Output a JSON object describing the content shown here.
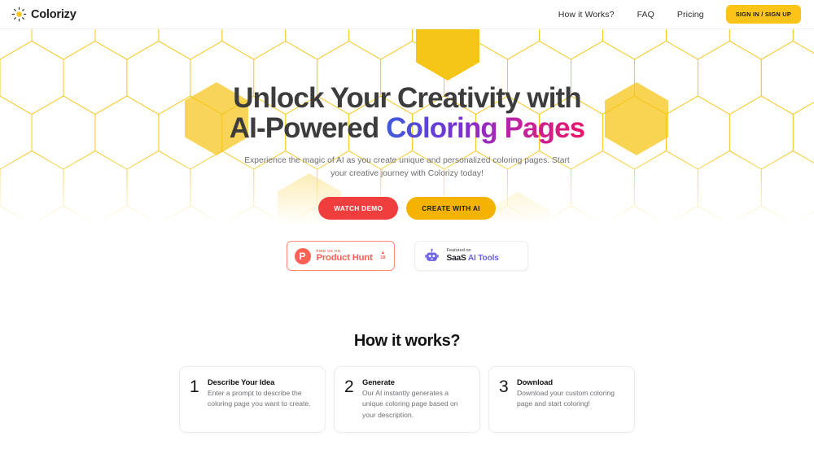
{
  "header": {
    "logo_icon": "sun-icon",
    "brand": "Colorizy",
    "nav": [
      {
        "label": "How it Works?"
      },
      {
        "label": "FAQ"
      },
      {
        "label": "Pricing"
      }
    ],
    "cta": "SIGN IN / SIGN UP",
    "cta_color": "#FCC419"
  },
  "hero": {
    "title_line1": "Unlock Your Creativity with",
    "title_line2_plain": "AI-Powered ",
    "title_line2_gradient": "Coloring Pages",
    "subtitle": "Experience the magic of AI as you create unique and personalized coloring pages. Start your creative journey with Colorizy today!",
    "buttons": [
      {
        "label": "WATCH DEMO",
        "color": "#F03E3E"
      },
      {
        "label": "CREATE WITH AI",
        "color": "#F5B301"
      }
    ],
    "background": "honeycomb-hexagon-pattern",
    "hex_color": "#F5C518"
  },
  "badges": {
    "product_hunt": {
      "icon": "product-hunt-icon",
      "eyebrow": "FIND US ON",
      "name": "Product Hunt",
      "upvote_icon": "caret-up-icon",
      "votes": "18",
      "color": "#FF6154"
    },
    "saas_ai_tools": {
      "icon": "robot-icon",
      "eyebrow": "Featured on",
      "name_bold": "SaaS",
      "name_accent": " AI Tools",
      "color": "#6C63E8"
    }
  },
  "how_it_works": {
    "title": "How it works?",
    "steps": [
      {
        "number": "1",
        "title": "Describe Your Idea",
        "description": "Enter a prompt to describe the coloring page you want to create."
      },
      {
        "number": "2",
        "title": "Generate",
        "description": "Our AI instantly generates a unique coloring page based on your description."
      },
      {
        "number": "3",
        "title": "Download",
        "description": "Download your custom coloring page and start coloring!"
      }
    ]
  }
}
